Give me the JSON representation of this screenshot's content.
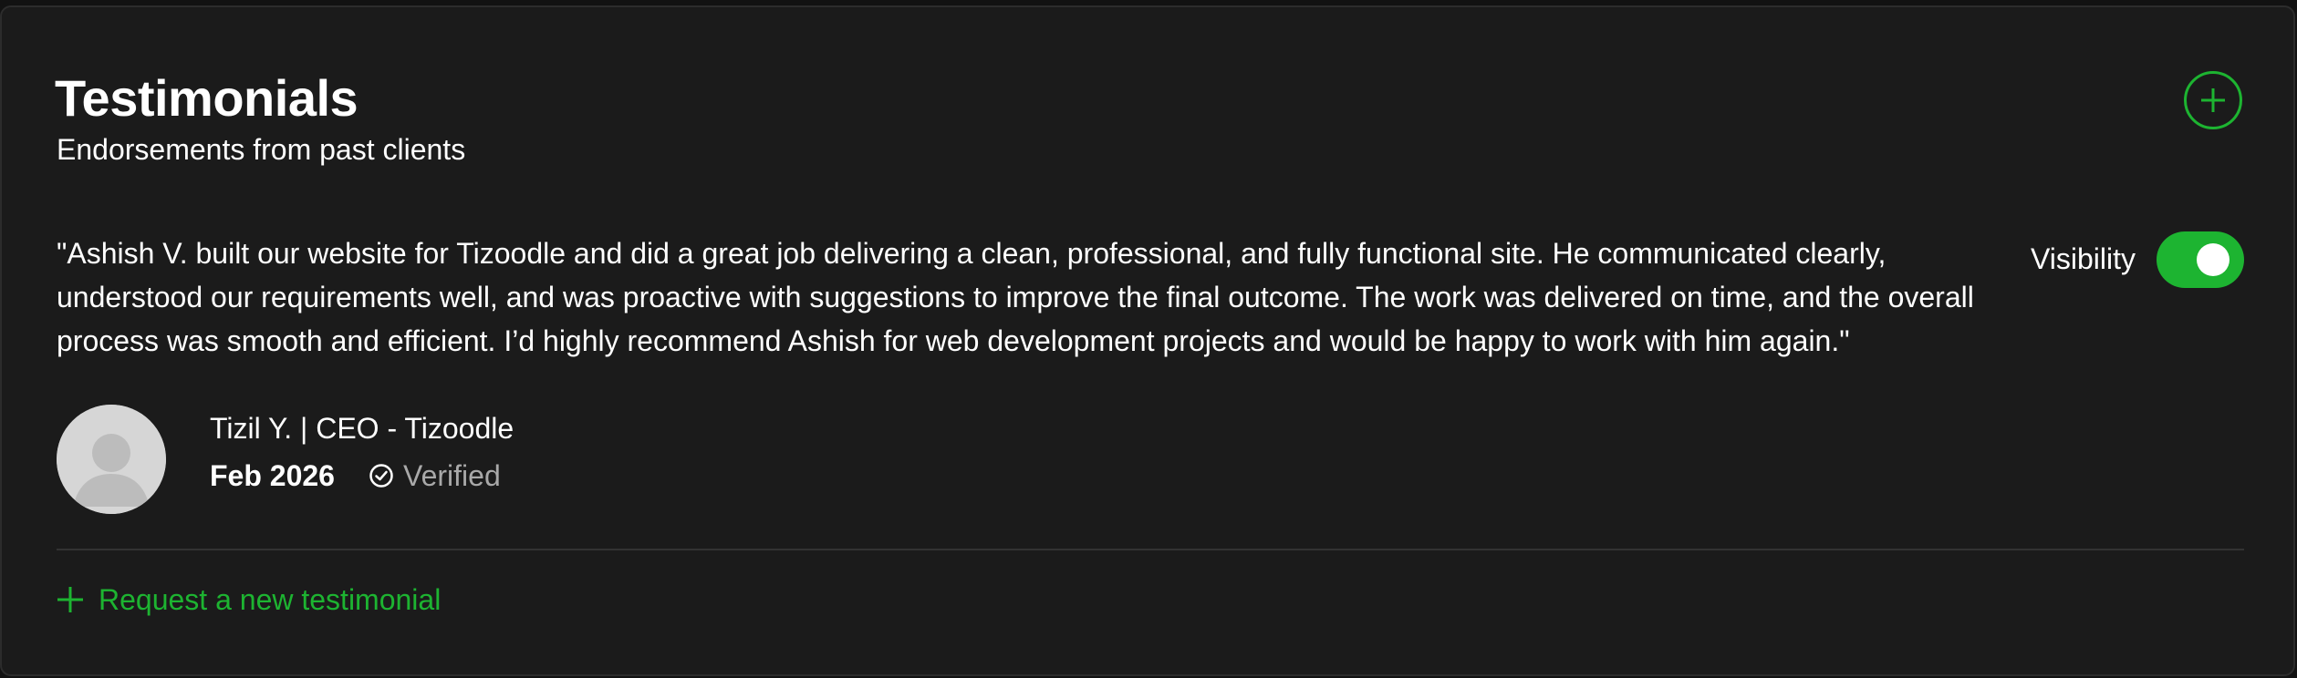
{
  "header": {
    "title": "Testimonials",
    "subtitle": "Endorsements from past clients"
  },
  "testimonial": {
    "quote": "\"Ashish V. built our website for Tizoodle and did a great job delivering a clean, professional, and fully functional site. He communicated clearly, understood our requirements well, and was proactive with suggestions to improve the final outcome. The work was delivered on time, and the overall process was smooth and efficient. I’d highly recommend Ashish for web development projects and would be happy to work with him again.\"",
    "visibility_label": "Visibility",
    "visibility_on": true,
    "author": "Tizil Y. | CEO - Tizoodle",
    "date": "Feb 2026",
    "verified_label": "Verified"
  },
  "footer": {
    "request_label": "Request a new testimonial"
  },
  "colors": {
    "accent": "#1db431",
    "card_background": "#1b1b1b",
    "muted_text": "#a9a9a9"
  },
  "icons": {
    "add": "plus-circle-icon",
    "verified": "check-circle-icon",
    "request": "plus-icon",
    "avatar": "user-placeholder-icon"
  }
}
